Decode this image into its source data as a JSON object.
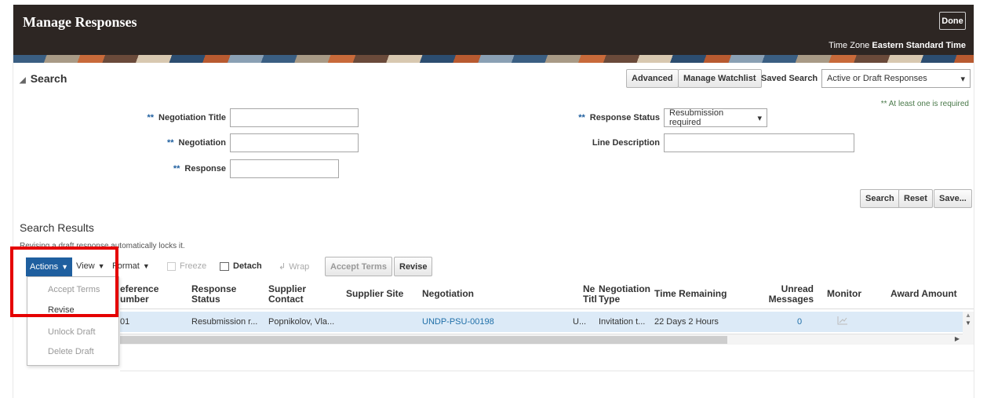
{
  "header": {
    "title": "Manage Responses",
    "done": "Done",
    "timezone_label": "Time Zone",
    "timezone_value": "Eastern Standard Time"
  },
  "search": {
    "title": "Search",
    "advanced": "Advanced",
    "manage_watchlist": "Manage Watchlist",
    "saved_search_label": "Saved Search",
    "saved_search_value": "Active or Draft Responses",
    "required_note": "** At least one is required",
    "fields": {
      "negotiation_title": "Negotiation Title",
      "negotiation": "Negotiation",
      "response": "Response",
      "response_status": "Response Status",
      "response_status_value": "Resubmission required",
      "line_description": "Line Description"
    },
    "req_marker": "**",
    "search_btn": "Search",
    "reset_btn": "Reset",
    "save_btn": "Save..."
  },
  "results": {
    "title": "Search Results",
    "info": "Revising a draft response automatically locks it.",
    "toolbar": {
      "actions": "Actions",
      "view": "View",
      "format": "Format",
      "freeze": "Freeze",
      "detach": "Detach",
      "wrap": "Wrap",
      "accept_terms": "Accept Terms",
      "revise": "Revise"
    },
    "columns": {
      "reference_number": [
        "eference",
        "umber"
      ],
      "response_status": [
        "Response",
        "Status"
      ],
      "supplier_contact": [
        "Supplier",
        "Contact"
      ],
      "supplier_site": "Supplier Site",
      "negotiation": "Negotiation",
      "ne_title": [
        "Ne",
        "Titl"
      ],
      "negotiation_type": [
        "Negotiation",
        "Type"
      ],
      "time_remaining": "Time Remaining",
      "unread_messages": [
        "Unread",
        "Messages"
      ],
      "monitor": "Monitor",
      "award_amount": "Award Amount"
    },
    "row": {
      "reference_number": "01",
      "response_status": "Resubmission r...",
      "supplier_contact": "Popnikolov, Vla...",
      "negotiation": "UNDP-PSU-00198",
      "ne_title": "U...",
      "negotiation_type": "Invitation t...",
      "time_remaining": "22 Days 2 Hours",
      "unread_messages": "0"
    }
  },
  "actions_menu": {
    "items": [
      {
        "label": "Accept Terms"
      },
      {
        "label": "Revise"
      },
      {
        "label": "Unlock Draft"
      },
      {
        "label": "Delete Draft"
      }
    ]
  }
}
